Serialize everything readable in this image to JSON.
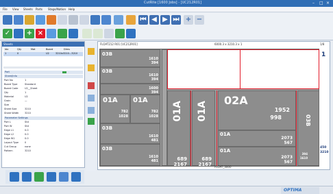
{
  "title": "CutRite  [1600 Jobs] - [UC212R01]",
  "window_controls": [
    "–",
    "□",
    "×"
  ],
  "menu": [
    "File",
    "View",
    "Sheets",
    "Parts",
    "Stage/Nation",
    "Help"
  ],
  "left_panel": {
    "title": "Sheets",
    "columns": [
      "Idx",
      "Qty",
      "Mat",
      "Board",
      "Dims"
    ],
    "row1": [
      "1",
      "0",
      "",
      "U2",
      "3210x3210...3210"
    ],
    "props_header": "Part",
    "sections": [
      "Sheet/Info",
      "Parameter Settings"
    ],
    "props": [
      {
        "k": "Part",
        "v": ""
      },
      {
        "k": "Part No",
        "v": "1"
      },
      {
        "k": "Board Type",
        "v": "Standard"
      },
      {
        "k": "Board Code",
        "v": "U2__Sheet"
      },
      {
        "k": "Qty",
        "v": "1"
      },
      {
        "k": "Material",
        "v": "U2"
      },
      {
        "k": "Grain",
        "v": "—"
      },
      {
        "k": "Size",
        "v": ""
      },
      {
        "k": "Sheet Size",
        "v": "3210"
      },
      {
        "k": "Sheet Width",
        "v": "3210"
      },
      {
        "k": "Part L",
        "v": "Std"
      },
      {
        "k": "Part W",
        "v": "Std"
      },
      {
        "k": "Edge L1",
        "v": "0.0"
      },
      {
        "k": "Edge L2",
        "v": "0.0"
      },
      {
        "k": "Edge W1",
        "v": "0.0"
      },
      {
        "k": "Layout Type",
        "v": "0"
      },
      {
        "k": "Cut Group",
        "v": "none"
      },
      {
        "k": "Pattern",
        "v": "3210"
      }
    ]
  },
  "canvas": {
    "header_left": "FLOAT212 R01 [UC212R01]",
    "header_mid": "6000.3 x 3210.3 x 1",
    "header_right": "1/8",
    "footer": "FLOAT_3000",
    "page_num": "1",
    "pieces": {
      "p1": {
        "code": "03B",
        "d1": "1610",
        "d2": "394"
      },
      "p2": {
        "code": "03B",
        "d1": "1610",
        "d2": "394"
      },
      "p3": {
        "code": "",
        "d1": "1600",
        "d2": "394"
      },
      "p4": {
        "code": "01A",
        "d1": "782",
        "d2": "1028"
      },
      "p5": {
        "code": "01A",
        "d1": "782",
        "d2": "1028"
      },
      "p6": {
        "code": "03B",
        "d1": "1610",
        "d2": "481"
      },
      "p7": {
        "code": "03B",
        "d1": "1610",
        "d2": "481"
      },
      "p8": {
        "code": "01A",
        "d1": "689",
        "d2": "2167"
      },
      "p9": {
        "code": "01A",
        "d1": "689",
        "d2": "2167"
      },
      "p10": {
        "code": "02A",
        "d1": "1952",
        "d2": "998"
      },
      "p11": {
        "code": "01A",
        "d1": "2073",
        "d2": "567"
      },
      "p12": {
        "code": "01A",
        "d1": "2073",
        "d2": "567"
      },
      "p13": {
        "code": "03B",
        "d1": "394",
        "d2": "1610"
      },
      "p14": {
        "code": "",
        "d1": "450",
        "d2": "3210"
      }
    }
  },
  "status_logo": "OPTIMA",
  "colors": {
    "titlebar": "#2f6db5",
    "accent_red": "#e21b2a",
    "piece_grey": "#8d8d8d",
    "panel_blue": "#3b6fb3"
  }
}
